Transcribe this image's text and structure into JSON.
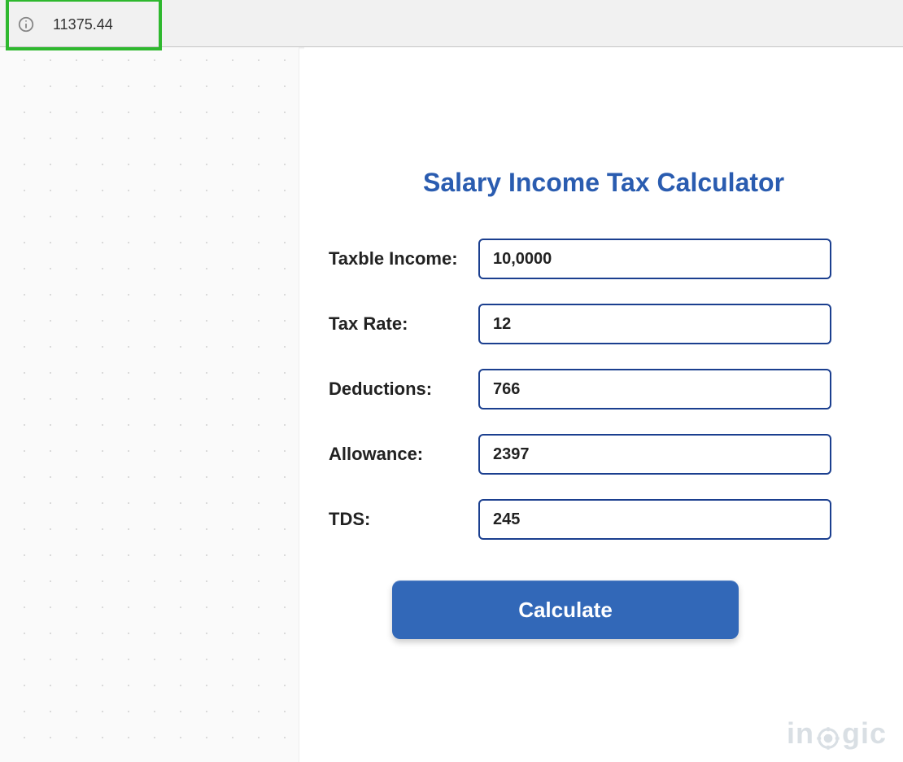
{
  "notification": {
    "value": "11375.44"
  },
  "calculator": {
    "title": "Salary Income Tax Calculator",
    "fields": {
      "taxable_income": {
        "label": "Taxble Income:",
        "value": "10,0000"
      },
      "tax_rate": {
        "label": "Tax Rate:",
        "value": "12"
      },
      "deductions": {
        "label": "Deductions:",
        "value": "766"
      },
      "allowance": {
        "label": "Allowance:",
        "value": "2397"
      },
      "tds": {
        "label": "TDS:",
        "value": "245"
      }
    },
    "button_label": "Calculate"
  },
  "watermark": {
    "part1": "in",
    "part2": "gic"
  }
}
